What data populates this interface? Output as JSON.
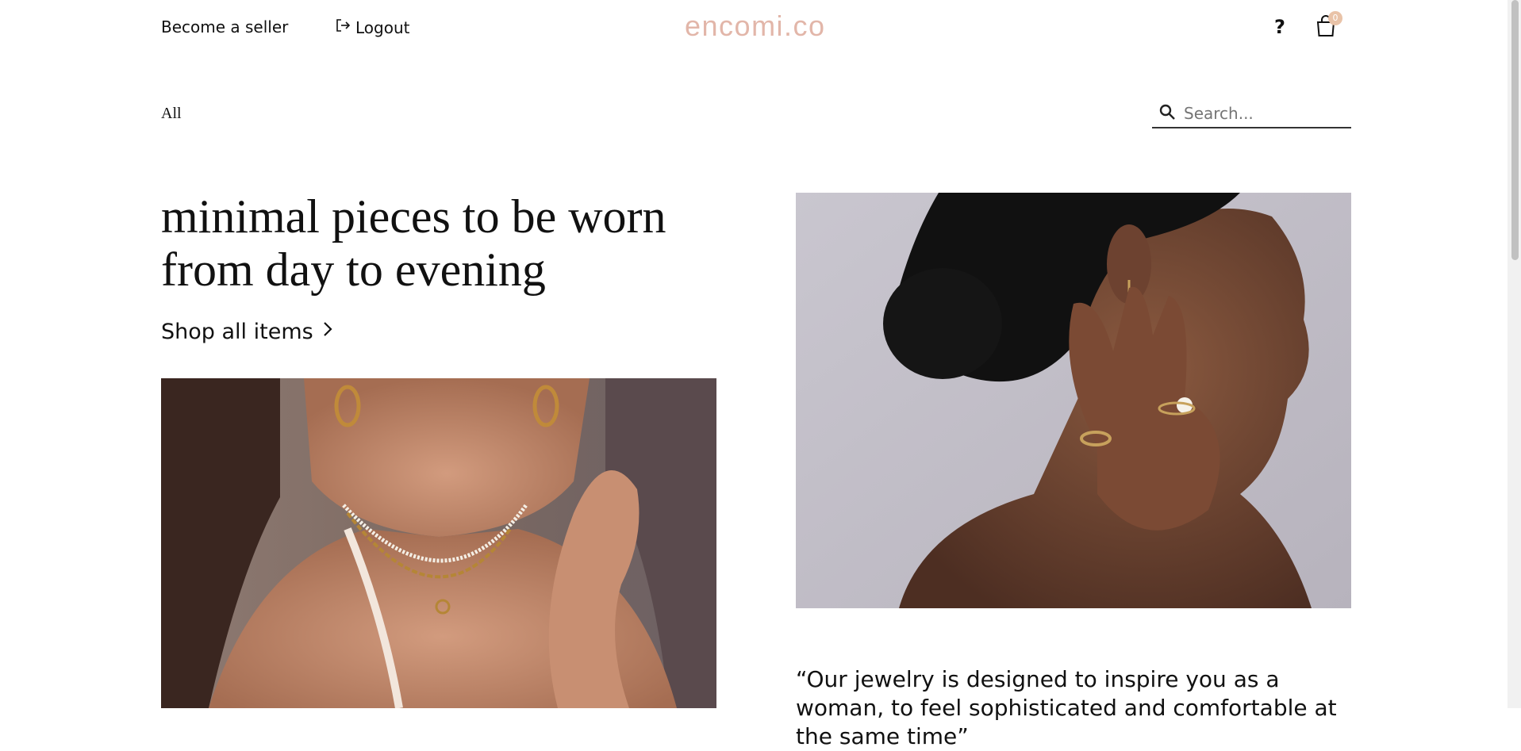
{
  "header": {
    "become_seller": "Become a seller",
    "logout": "Logout",
    "logo": "encomi.co",
    "help": "?",
    "cart_count": "0"
  },
  "filter": {
    "category": "All",
    "search_placeholder": "Search..."
  },
  "hero": {
    "title": "minimal pieces to be worn from day to evening",
    "shop_all": "Shop all items"
  },
  "quote": {
    "text": "“Our jewelry is designed to inspire you as a woman, to feel sophisticated and comfortable at the same time”"
  },
  "icons": {
    "logout": "logout-icon",
    "cart": "shopping-bag-icon",
    "search": "search-icon",
    "chevron": "chevron-right-icon"
  },
  "colors": {
    "logo": "#e2b6a9",
    "badge": "#e9c3a8"
  }
}
